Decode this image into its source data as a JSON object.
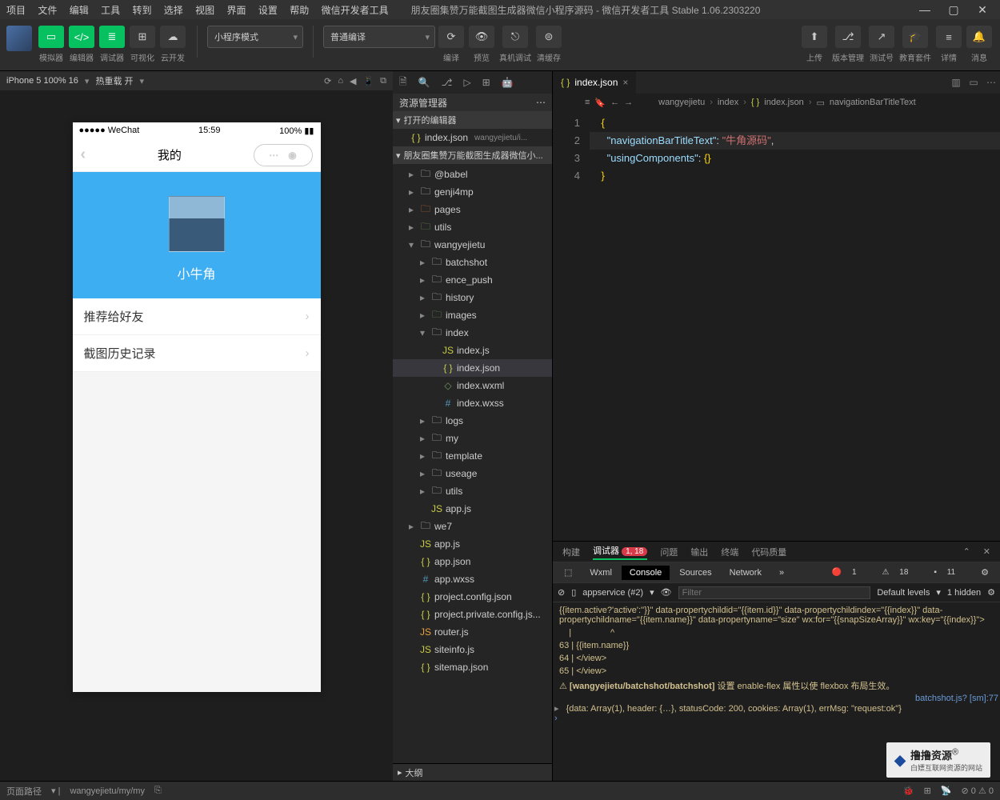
{
  "titlebar": {
    "menus": [
      "项目",
      "文件",
      "编辑",
      "工具",
      "转到",
      "选择",
      "视图",
      "界面",
      "设置",
      "帮助",
      "微信开发者工具"
    ],
    "title": "朋友圈集赞万能截图生成器微信小程序源码 - 微信开发者工具 Stable 1.06.2303220"
  },
  "toolbar": {
    "simulator": "模拟器",
    "editor": "编辑器",
    "debugger": "调试器",
    "visualize": "可视化",
    "cloud": "云开发",
    "mode": "小程序模式",
    "compile": "普通编译",
    "compile_btn": "编译",
    "preview": "预览",
    "remote": "真机调试",
    "cache": "清缓存",
    "upload": "上传",
    "version": "版本管理",
    "test": "测试号",
    "edu": "教育套件",
    "detail": "详情",
    "msg": "消息"
  },
  "simhead": {
    "device": "iPhone 5 100% 16",
    "reload": "热重载 开"
  },
  "phone": {
    "carrier": "WeChat",
    "time": "15:59",
    "batt": "100%",
    "nav_title": "我的",
    "username": "小牛角",
    "row1": "推荐给好友",
    "row2": "截图历史记录"
  },
  "explorer": {
    "title": "资源管理器",
    "open_editors": "打开的编辑器",
    "open_file": "index.json",
    "open_file_path": "wangyejietu/i...",
    "project": "朋友圈集赞万能截图生成器微信小...",
    "tree": [
      {
        "d": 1,
        "t": "folder",
        "n": "@babel",
        "c": ""
      },
      {
        "d": 1,
        "t": "folder",
        "n": "genji4mp",
        "c": ""
      },
      {
        "d": 1,
        "t": "folder",
        "n": "pages",
        "c": "fc-red"
      },
      {
        "d": 1,
        "t": "folder",
        "n": "utils",
        "c": "fc-green"
      },
      {
        "d": 1,
        "t": "folder-open",
        "n": "wangyejietu",
        "c": ""
      },
      {
        "d": 2,
        "t": "folder",
        "n": "batchshot",
        "c": ""
      },
      {
        "d": 2,
        "t": "folder",
        "n": "ence_push",
        "c": ""
      },
      {
        "d": 2,
        "t": "folder",
        "n": "history",
        "c": ""
      },
      {
        "d": 2,
        "t": "folder",
        "n": "images",
        "c": "fc-green"
      },
      {
        "d": 2,
        "t": "folder-open",
        "n": "index",
        "c": ""
      },
      {
        "d": 3,
        "t": "js",
        "n": "index.js",
        "c": "fc-yellow"
      },
      {
        "d": 3,
        "t": "json",
        "n": "index.json",
        "c": "fc-yellow",
        "sel": true
      },
      {
        "d": 3,
        "t": "wxml",
        "n": "index.wxml",
        "c": "fc-green"
      },
      {
        "d": 3,
        "t": "wxss",
        "n": "index.wxss",
        "c": "fc-blue"
      },
      {
        "d": 2,
        "t": "folder",
        "n": "logs",
        "c": ""
      },
      {
        "d": 2,
        "t": "folder",
        "n": "my",
        "c": ""
      },
      {
        "d": 2,
        "t": "folder",
        "n": "template",
        "c": ""
      },
      {
        "d": 2,
        "t": "folder",
        "n": "useage",
        "c": ""
      },
      {
        "d": 2,
        "t": "folder",
        "n": "utils",
        "c": ""
      },
      {
        "d": 2,
        "t": "js",
        "n": "app.js",
        "c": "fc-yellow"
      },
      {
        "d": 1,
        "t": "folder",
        "n": "we7",
        "c": ""
      },
      {
        "d": 1,
        "t": "js",
        "n": "app.js",
        "c": "fc-yellow"
      },
      {
        "d": 1,
        "t": "json",
        "n": "app.json",
        "c": "fc-yellow"
      },
      {
        "d": 1,
        "t": "wxss",
        "n": "app.wxss",
        "c": "fc-blue"
      },
      {
        "d": 1,
        "t": "json",
        "n": "project.config.json",
        "c": "fc-yellow"
      },
      {
        "d": 1,
        "t": "json",
        "n": "project.private.config.js...",
        "c": "fc-yellow"
      },
      {
        "d": 1,
        "t": "js",
        "n": "router.js",
        "c": "fc-orange"
      },
      {
        "d": 1,
        "t": "js",
        "n": "siteinfo.js",
        "c": "fc-yellow"
      },
      {
        "d": 1,
        "t": "json",
        "n": "sitemap.json",
        "c": "fc-yellow"
      }
    ],
    "outline": "大纲"
  },
  "editor": {
    "tab": "index.json",
    "crumbs": [
      "wangyejietu",
      "index",
      "index.json",
      "navigationBarTitleText"
    ],
    "code": {
      "l1": "{",
      "l2_key": "\"navigationBarTitleText\"",
      "l2_val": "\"牛角源码\"",
      "l3_key": "\"usingComponents\"",
      "l3_val": "{}",
      "l4": "}"
    }
  },
  "console": {
    "tabs": {
      "build": "构建",
      "debugger": "调试器",
      "badge": "1, 18",
      "problems": "问题",
      "output": "输出",
      "terminal": "终端",
      "quality": "代码质量"
    },
    "devtabs": {
      "wxml": "Wxml",
      "console": "Console",
      "sources": "Sources",
      "network": "Network"
    },
    "stat_err": "1",
    "stat_warn": "18",
    "stat_info": "11",
    "filter": {
      "ctx": "appservice (#2)",
      "ph": "Filter",
      "lvl": "Default levels",
      "hidden": "1 hidden"
    },
    "w1": "{{item.active?'active':''}}\" data-propertychildid=\"{{item.id}}\" data-propertychildindex=\"{{index}}\" data-propertychildname=\"{{item.name}}\" data-propertyname=\"size\" wx:for=\"{{snapSizeArray}}\" wx:key=\"{{index}}\">",
    "w2_63": "63 |                       {{item.name}}",
    "w2_64": "64 |                   </view>",
    "w2_65": "65 |               </view>",
    "w3_pre": "[wangyejietu/batchshot/batchshot]",
    "w3": " 设置 enable-flex 属性以使 flexbox 布局生效。",
    "link": "batchshot.js? [sm]:77",
    "w4": "{data: Array(1), header: {…}, statusCode: 200, cookies: Array(1), errMsg: \"request:ok\"}"
  },
  "footer": {
    "path_lbl": "页面路径",
    "path": "wangyejietu/my/my",
    "errs": "⊘ 0 ⚠ 0"
  },
  "watermark": {
    "name": "撸撸资源",
    "tag": "®",
    "sub": "白嫖互联网资源的网站"
  }
}
